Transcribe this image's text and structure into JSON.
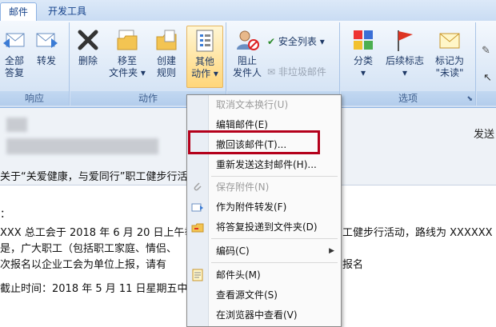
{
  "tabs": [
    {
      "label": "邮件",
      "active": true
    },
    {
      "label": "开发工具",
      "active": false
    }
  ],
  "ribbon": {
    "respond": {
      "label": "响应",
      "buttons": [
        {
          "label_line1": "全部",
          "label_line2": "答复"
        },
        {
          "label_line1": "转发",
          "label_line2": ""
        }
      ]
    },
    "actions": {
      "label": "动作",
      "buttons": [
        {
          "label_line1": "删除",
          "label_line2": ""
        },
        {
          "label_line1": "移至",
          "label_line2": "文件夹 ▾"
        },
        {
          "label_line1": "创建",
          "label_line2": "规则"
        },
        {
          "label_line1": "其他",
          "label_line2": "动作 ▾"
        }
      ]
    },
    "junk": {
      "block_label_line1": "阻止",
      "block_label_line2": "发件人",
      "safe_list": "安全列表 ▾",
      "not_junk": "非垃圾邮件"
    },
    "options": {
      "label": "选项",
      "buttons": [
        {
          "label_line1": "分类",
          "label_line2": "▾"
        },
        {
          "label_line1": "后续标志",
          "label_line2": "▾"
        },
        {
          "label_line1": "标记为",
          "label_line2": "\"未读\""
        }
      ]
    }
  },
  "email": {
    "send_label": "发送",
    "subject": "关于“关爱健康，与爱同行”职工健步行活动",
    "body_lines": [
      "：",
      "XXX 总工会于 2018 年 6 月 20 日上午举",
      "是，广大职工（包括职工家庭、情侣、",
      "次报名以企业工会为单位上报，请有",
      "截止时间：2018 年 5 月 11 日星期五中"
    ],
    "body_right_1": "工健步行活动，路线为 XXXXXX",
    "body_right_3": "报名"
  },
  "menu": {
    "items": [
      {
        "label": "取消文本换行(U)",
        "disabled": true,
        "icon": ""
      },
      {
        "label": "编辑邮件(E)",
        "disabled": false,
        "icon": ""
      },
      {
        "label": "撤回该邮件(T)...",
        "disabled": false,
        "icon": ""
      },
      {
        "label": "重新发送这封邮件(H)...",
        "disabled": false,
        "icon": ""
      },
      {
        "label": "保存附件(N)",
        "disabled": true,
        "icon": "paperclip-icon"
      },
      {
        "label": "作为附件转发(F)",
        "disabled": false,
        "icon": "forward-attachment-icon"
      },
      {
        "label": "将答复投递到文件夹(D)",
        "disabled": false,
        "icon": "deliver-folder-icon"
      },
      {
        "label": "编码(C)",
        "disabled": false,
        "icon": "",
        "submenu": true
      },
      {
        "label": "邮件头(M)",
        "disabled": false,
        "icon": "message-header-icon"
      },
      {
        "label": "查看源文件(S)",
        "disabled": false,
        "icon": ""
      },
      {
        "label": "在浏览器中查看(V)",
        "disabled": false,
        "icon": ""
      }
    ]
  },
  "colors": {
    "accent": "#15428b",
    "highlight_border": "#b4001b"
  }
}
